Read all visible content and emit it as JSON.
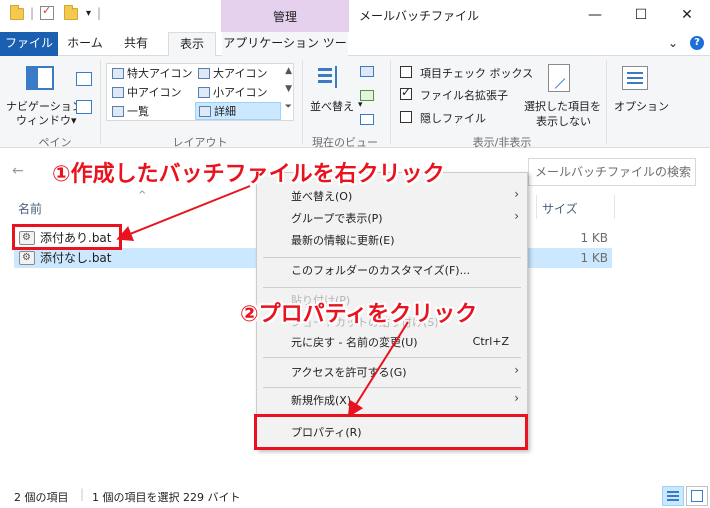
{
  "titlebar": {
    "manage_tab": "管理",
    "window_title": "メールバッチファイル",
    "minimize": "—",
    "maximize": "☐",
    "close": "✕"
  },
  "tabs": {
    "file": "ファイル",
    "home": "ホーム",
    "share": "共有",
    "view": "表示",
    "app_tools": "アプリケーション ツール",
    "expand_icon": "⌄",
    "help_icon": "?"
  },
  "ribbon": {
    "nav_pane": {
      "line1": "ナビゲーション",
      "line2": "ウィンドウ▾"
    },
    "pane_group_label": "ペイン",
    "layout_items": [
      "特大アイコン",
      "大アイコン",
      "中アイコン",
      "小アイコン",
      "一覧",
      "詳細"
    ],
    "layout_group_label": "レイアウト",
    "sort": "並べ替え",
    "current_view_label": "現在のビュー",
    "item_checkbox": "項目チェック ボックス",
    "file_ext": "ファイル名拡張子",
    "hidden_files": "隠しファイル",
    "hide_selected": {
      "line1": "選択した項目を",
      "line2": "表示しない"
    },
    "options": "オプション",
    "showhide_label": "表示/非表示"
  },
  "search": {
    "placeholder": "メールバッチファイルの検索"
  },
  "columns": {
    "name": "名前",
    "size": "サイズ"
  },
  "files": [
    {
      "name": "添付あり.bat",
      "size": "1 KB"
    },
    {
      "name": "添付なし.bat",
      "size": "1 KB"
    }
  ],
  "context_menu": {
    "sort": "並べ替え(O)",
    "group": "グループで表示(P)",
    "refresh": "最新の情報に更新(E)",
    "customize": "このフォルダーのカスタマイズ(F)...",
    "paste": "貼り付け(P)",
    "paste_shortcut": "ショートカットの貼り付け(S)",
    "undo": "元に戻す - 名前の変更(U)",
    "undo_shortcut": "Ctrl+Z",
    "access": "アクセスを許可する(G)",
    "new": "新規作成(X)",
    "properties": "プロパティ(R)"
  },
  "annotations": {
    "step1": "①作成したバッチファイルを右クリック",
    "step2": "②プロパティをクリック",
    "color": "#e8131e"
  },
  "status": {
    "count": "2 個の項目",
    "selection": "1 個の項目を選択 229 バイト"
  }
}
